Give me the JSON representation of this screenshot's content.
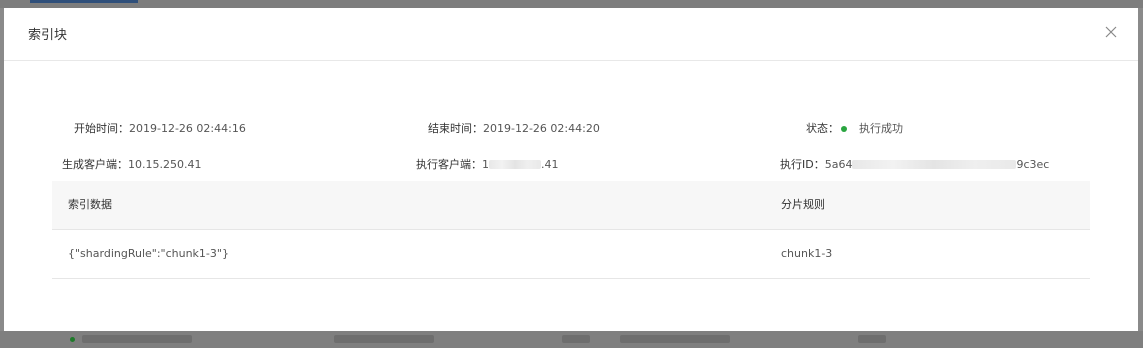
{
  "modal": {
    "title": "索引块",
    "close_icon": "close-icon"
  },
  "info": {
    "start_time": {
      "label": "开始时间：",
      "value": "2019-12-26 02:44:16"
    },
    "end_time": {
      "label": "结束时间：",
      "value": "2019-12-26 02:44:20"
    },
    "status": {
      "label": "状态：",
      "value": "执行成功",
      "color": "#2aa540"
    },
    "gen_client": {
      "label": "生成客户端：",
      "value": "10.15.250.41"
    },
    "exec_client": {
      "label": "执行客户端：",
      "value_prefix": "1",
      "value_suffix": ".41"
    },
    "exec_id": {
      "label": "执行ID：",
      "value_prefix": "5a64",
      "value_suffix": "9c3ec"
    }
  },
  "table": {
    "headers": [
      "索引数据",
      "分片规则"
    ],
    "rows": [
      [
        "{\"shardingRule\":\"chunk1-3\"}",
        "chunk1-3"
      ]
    ]
  }
}
